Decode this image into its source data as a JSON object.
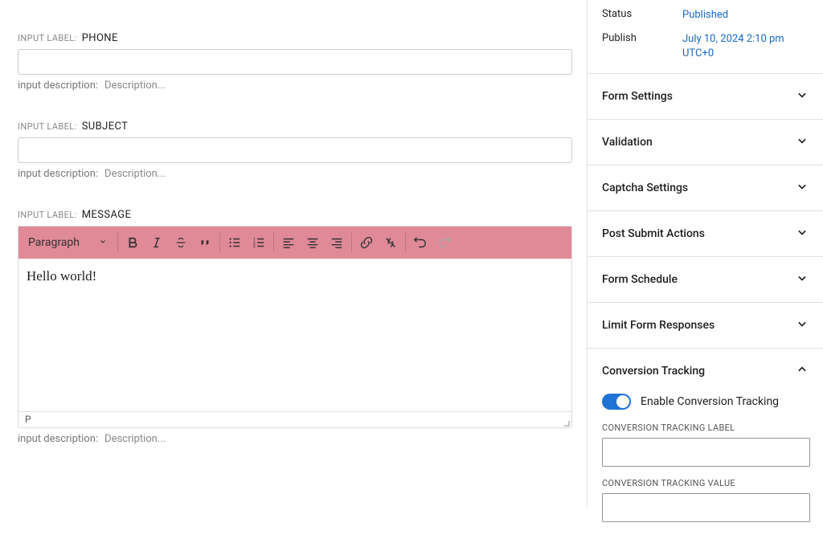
{
  "labels": {
    "input_label_prefix": "INPUT LABEL:",
    "input_description_prefix": "input description:",
    "description_placeholder": "Description..."
  },
  "fields": {
    "phone": {
      "label": "PHONE",
      "value": ""
    },
    "subject": {
      "label": "SUBJECT",
      "value": ""
    },
    "message": {
      "label": "MESSAGE",
      "content": "Hello world!"
    }
  },
  "rte": {
    "format_label": "Paragraph",
    "status_path": "P"
  },
  "sidebar": {
    "meta": {
      "status_label": "Status",
      "status_value": "Published",
      "publish_label": "Publish",
      "publish_value": "July 10, 2024 2:10 pm UTC+0"
    },
    "panels": {
      "form_settings": "Form Settings",
      "validation": "Validation",
      "captcha": "Captcha Settings",
      "post_submit": "Post Submit Actions",
      "form_schedule": "Form Schedule",
      "limit_responses": "Limit Form Responses",
      "conversion_tracking": "Conversion Tracking"
    },
    "conversion": {
      "enable_label": "Enable Conversion Tracking",
      "label_field": "CONVERSION TRACKING LABEL",
      "value_field": "CONVERSION TRACKING VALUE",
      "label_value": "",
      "value_value": ""
    }
  }
}
